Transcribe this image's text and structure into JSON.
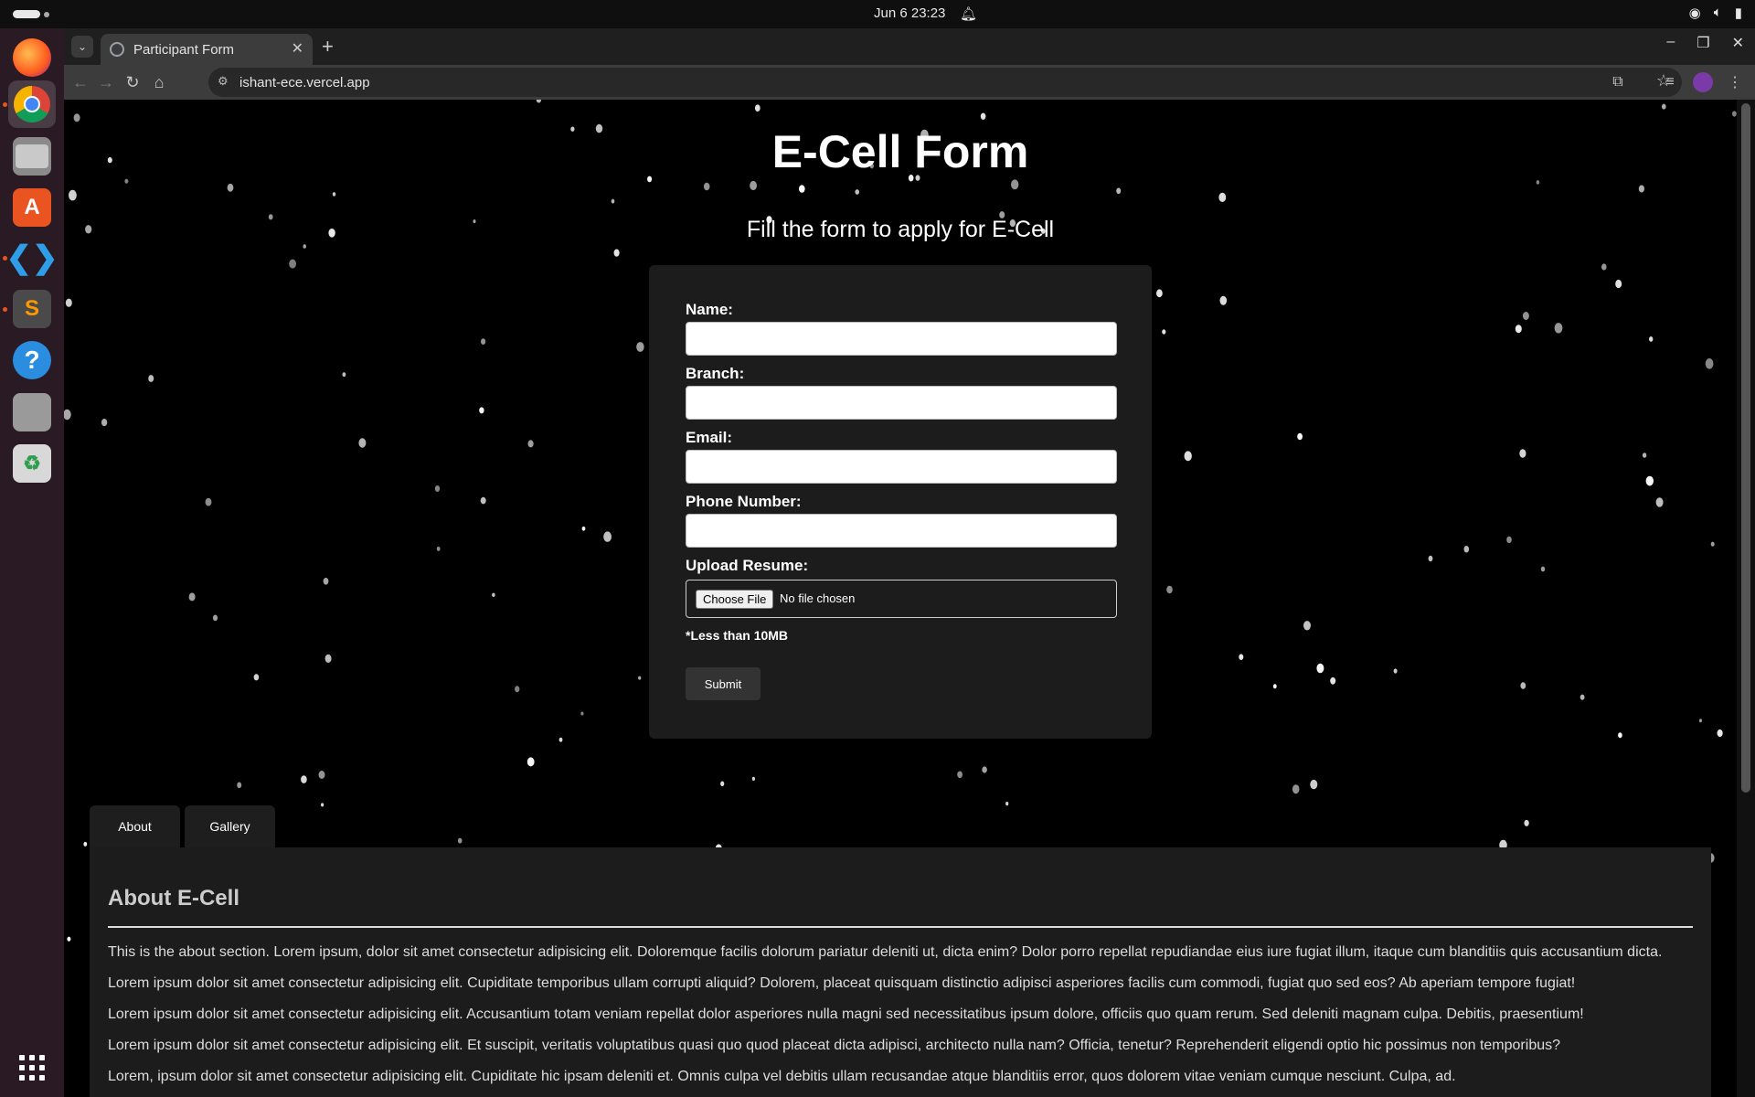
{
  "system": {
    "clock": "Jun 6  23:23"
  },
  "browser": {
    "tab_title": "Participant Form",
    "url": "ishant-ece.vercel.app"
  },
  "page": {
    "title": "E-Cell Form",
    "subtitle": "Fill the form to apply for E-Cell",
    "form": {
      "name_label": "Name:",
      "branch_label": "Branch:",
      "email_label": "Email:",
      "phone_label": "Phone Number:",
      "resume_label": "Upload Resume:",
      "choose_file": "Choose File",
      "no_file": "No file chosen",
      "size_note": "*Less than 10MB",
      "submit": "Submit"
    },
    "tabs": [
      "About",
      "Gallery"
    ],
    "about": {
      "heading": "About E-Cell",
      "paragraphs": [
        "This is the about section. Lorem ipsum, dolor sit amet consectetur adipisicing elit. Doloremque facilis dolorum pariatur deleniti ut, dicta enim? Dolor porro repellat repudiandae eius iure fugiat illum, itaque cum blanditiis quis accusantium dicta.",
        "Lorem ipsum dolor sit amet consectetur adipisicing elit. Cupiditate temporibus ullam corrupti aliquid? Dolorem, placeat quisquam distinctio adipisci asperiores facilis cum commodi, fugiat quo sed eos? Ab aperiam tempore fugiat!",
        "Lorem ipsum dolor sit amet consectetur adipisicing elit. Accusantium totam veniam repellat dolor asperiores nulla magni sed necessitatibus ipsum dolore, officiis quo quam rerum. Sed deleniti magnam culpa. Debitis, praesentium!",
        "Lorem ipsum dolor sit amet consectetur adipisicing elit. Et suscipit, veritatis voluptatibus quasi quo quod placeat dicta adipisci, architecto nulla nam? Officia, tenetur? Reprehenderit eligendi optio hic possimus non temporibus?",
        "Lorem, ipsum dolor sit amet consectetur adipisicing elit. Cupiditate hic ipsam deleniti et. Omnis culpa vel debitis ullam recusandae atque blanditiis error, quos dolorem vitae veniam cumque nesciunt. Culpa, ad."
      ]
    }
  },
  "icons": {
    "dock": [
      "firefox-icon",
      "chrome-icon",
      "files-icon",
      "app-center-icon",
      "vscode-icon",
      "sublime-text-icon",
      "help-icon",
      "disk-icon",
      "trash-icon",
      "app-grid-icon"
    ]
  }
}
